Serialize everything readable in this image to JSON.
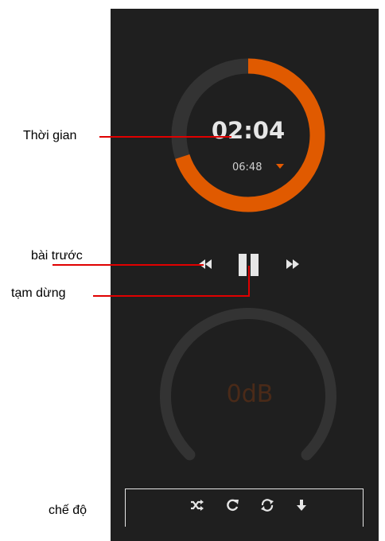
{
  "annotations": {
    "time": "Thời gian",
    "previous": "bài trước",
    "pause": "tạm dừng",
    "mode": "chế độ"
  },
  "player": {
    "elapsed": "02:04",
    "duration": "06:48",
    "progress": 0.3,
    "accent_color": "#e05a00",
    "track_color": "#333333"
  },
  "controls": {
    "previous_icon": "rewind-icon",
    "pause_icon": "pause-icon",
    "next_icon": "fast-forward-icon"
  },
  "volume": {
    "label": "0dB",
    "level": 0
  },
  "modes": {
    "items": [
      "shuffle-icon",
      "repeat-one-icon",
      "repeat-all-icon",
      "download-icon"
    ]
  }
}
